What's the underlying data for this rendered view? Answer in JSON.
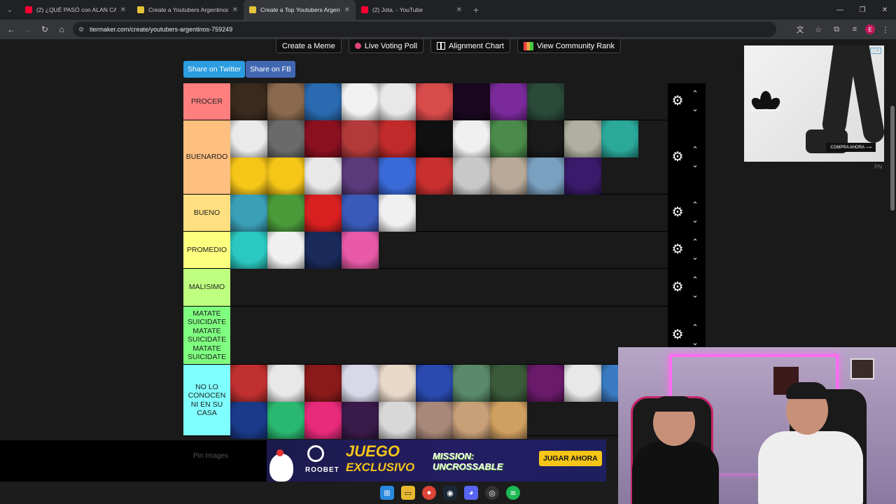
{
  "browser": {
    "tabs": [
      {
        "title": "(2) ¿QUÉ PASÓ con ALAN CAB…",
        "type": "yt",
        "active": false
      },
      {
        "title": "Create a Youtubers Argentinos…",
        "type": "tm",
        "active": false
      },
      {
        "title": "Create a Top Youtubers Argenti…",
        "type": "tm",
        "active": true
      },
      {
        "title": "(2) Jota. - YouTube",
        "type": "yt",
        "active": false
      }
    ],
    "url": "tiermaker.com/create/youtubers-argentinos-759249",
    "profile_initial": "E"
  },
  "toolbar": {
    "create_meme": "Create a Meme",
    "live_poll": "Live Voting Poll",
    "alignment_chart": "Alignment Chart",
    "community_rank": "View Community Rank"
  },
  "share": {
    "twitter": "Share on Twitter",
    "facebook": "Share on FB"
  },
  "tiers": [
    {
      "label": "PROCER",
      "color": "#ff7f7f",
      "items": [
        "#3a2a1e",
        "#8a6a4e",
        "#2a6ab0",
        "#f2f2f2",
        "#e8e8e8",
        "#d84b4b",
        "#1a0820",
        "#7a2a9a",
        "#2a4a3a"
      ],
      "item_count": 9
    },
    {
      "label": "BUENARDO",
      "color": "#ffbf7f",
      "items": [
        "#eaeaea",
        "#6a6a6a",
        "#8a1020",
        "#b23a3a",
        "#c02a2a",
        "#101010",
        "#f0f0f0",
        "#4a8a4a",
        "#1a1a1a",
        "#b0b0a0",
        "#2aa89a",
        "#f5c518",
        "#f5c518",
        "#e8e8e8",
        "#5a3a7a",
        "#3a6ad8",
        "#c83030",
        "#c8c8c8",
        "#b8a898",
        "#7aa0c0",
        "#3a1a6a"
      ],
      "item_count": 21
    },
    {
      "label": "BUENO",
      "color": "#ffdf7f",
      "items": [
        "#3aa0b8",
        "#4a9a3a",
        "#d82020",
        "#3a5ab8",
        "#f0f0f0"
      ],
      "item_count": 5
    },
    {
      "label": "PROMEDIO",
      "color": "#ffff7f",
      "items": [
        "#2ac8c0",
        "#f0f0f0",
        "#1a2a5a",
        "#e85aa8"
      ],
      "item_count": 4
    },
    {
      "label": "MALISIMO",
      "color": "#bfff7f",
      "items": [],
      "item_count": 0
    },
    {
      "label": "MATATE SUICIDATE MATATE SUICIDATE MATATE SUICIDATE",
      "color": "#7fff7f",
      "items": [],
      "item_count": 0
    },
    {
      "label": "NO LO CONOCEN NI EN SU CASA",
      "color": "#7fffff",
      "items": [
        "#c03030",
        "#e8e8e8",
        "#8a1a1a",
        "#d8d8e8",
        "#e8d8c8",
        "#2a4ab0",
        "#5a8a6a",
        "#3a5a3a",
        "#6a1a6a",
        "#e8e8e8",
        "#3a7ac0",
        "#1a3a8a",
        "#2ab870",
        "#e82a7a",
        "#3a1a4a",
        "#d8d8d8",
        "#a88878",
        "#c8a078",
        "#d0a060"
      ],
      "item_count": 19
    }
  ],
  "ads": {
    "side_cta": "COMPRA AHORA ⟶",
    "side_brand": "PN",
    "bottom_brand": "ROOBET",
    "bottom_headline": "JUEGO",
    "bottom_subhead": "EXCLUSIVO",
    "bottom_game": "MISSION: UNCROSSABLE",
    "bottom_cta": "JUGAR AHORA"
  },
  "hidden_footer": "Pin Images",
  "colors": {
    "twitter": "#2b9de0",
    "facebook": "#4267b2",
    "chrome_dark": "#202124",
    "chrome_bar": "#35363a"
  }
}
